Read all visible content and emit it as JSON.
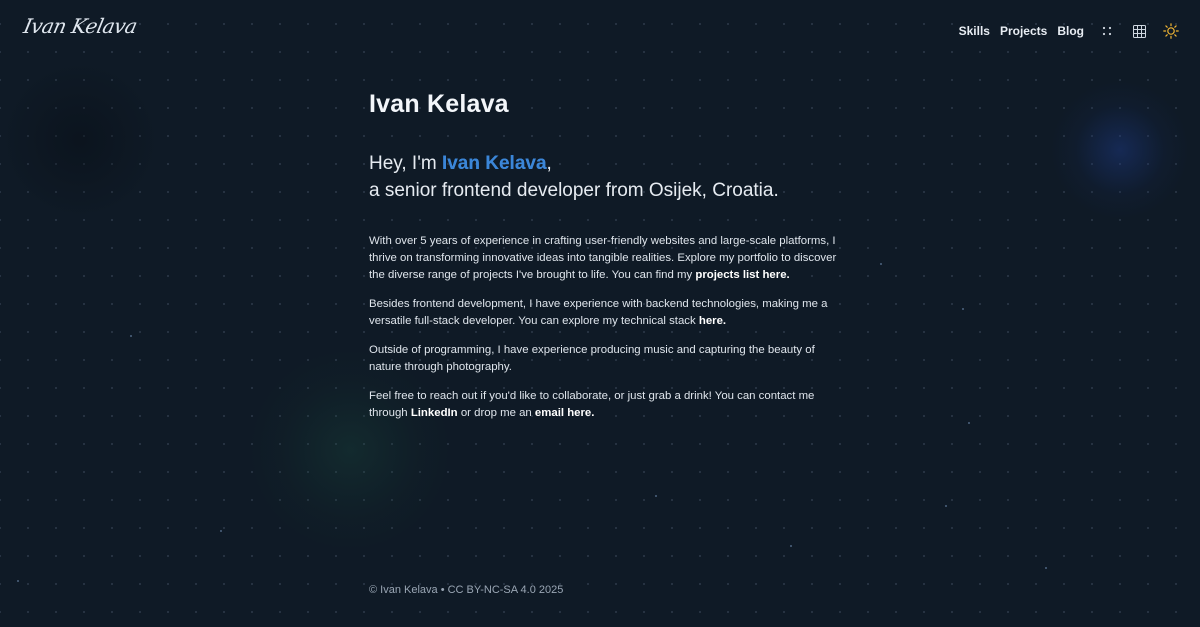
{
  "logo": {
    "text": "Ivan Kelava"
  },
  "nav": {
    "links": [
      {
        "label": "Skills"
      },
      {
        "label": "Projects"
      },
      {
        "label": "Blog"
      }
    ],
    "icons": [
      "dots-menu-icon",
      "grid-icon",
      "sun-icon"
    ]
  },
  "main": {
    "title": "Ivan Kelava",
    "intro": {
      "prefix": "Hey, I'm ",
      "name": "Ivan Kelava",
      "suffix": ",",
      "line2": "a senior frontend developer from Osijek, Croatia."
    },
    "p1": {
      "text": "With over 5 years of experience in crafting user-friendly websites and large-scale platforms, I thrive on transforming innovative ideas into tangible realities. Explore my portfolio to discover the diverse range of projects I've brought to life. You can find my ",
      "link": "projects list here."
    },
    "p2": {
      "text": "Besides frontend development, I have experience with backend technologies, making me a versatile full-stack developer. You can explore my technical stack ",
      "link": "here."
    },
    "p3": {
      "text": "Outside of programming, I have experience producing music and capturing the beauty of nature through photography."
    },
    "p4": {
      "text": "Feel free to reach out if you'd like to collaborate, or just grab a drink! You can contact me through ",
      "link1": "LinkedIn",
      "mid": " or drop me an ",
      "link2": "email here."
    }
  },
  "footer": {
    "text": "© Ivan Kelava • CC BY-NC-SA 4.0 2025"
  },
  "colors": {
    "background": "#0f1a26",
    "accent": "#3b86d8",
    "sun": "#f2b634"
  }
}
